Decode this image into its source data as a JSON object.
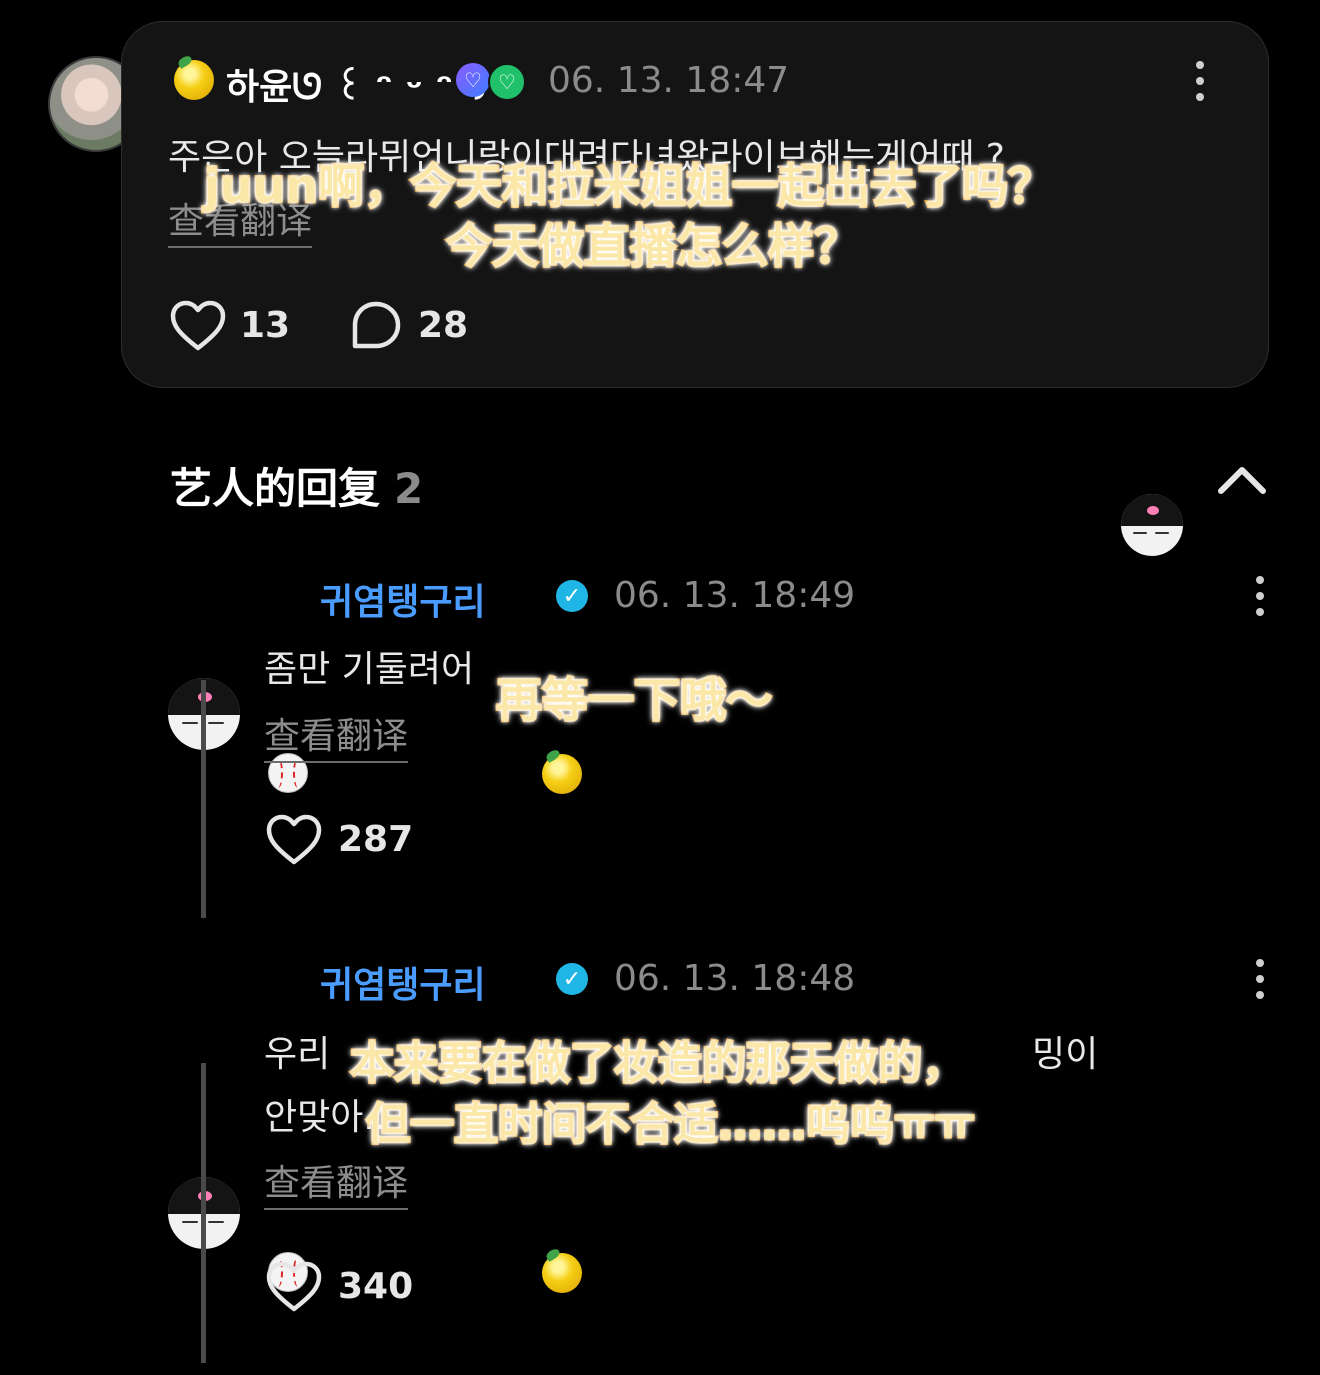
{
  "post": {
    "author_name": "하윤ᘎ ꒰ ᵔ ᵕ ᵔ ꒱ᘎ",
    "timestamp": "06. 13. 18:47",
    "body": "주은아 오늘라뮈언니랑이대려다녀왔라이브해는게어때 ?",
    "translate_label": "查看翻译",
    "like_count": "13",
    "comment_count": "28",
    "icons": [
      "lemon-emoji-icon",
      "weverse-badge-icon",
      "green-heart-badge-icon",
      "more-vert-icon",
      "heart-icon",
      "comment-icon"
    ]
  },
  "replies_header": {
    "title": "艺人的回复",
    "count": "2",
    "collapse_icon": "chevron-up-icon"
  },
  "replies": [
    {
      "author": "귀염탱구리",
      "timestamp": "06. 13. 18:49",
      "body": "좀만 기둘려어",
      "translate_label": "查看翻译",
      "like_count": "287"
    },
    {
      "author": "귀염탱구리",
      "timestamp": "06. 13. 18:48",
      "body_line1_start": "우리",
      "body_line1_end": "밍이",
      "body_line2": "안맞아..",
      "translate_label": "查看翻译",
      "like_count": "340"
    }
  ],
  "subtitles": {
    "post_line1": "juun啊，今天和拉米姐姐一起出去了吗？",
    "post_line2": "今天做直播怎么样？",
    "reply1": "再等一下哦～",
    "reply2_line1": "本来要在做了妆造的那天做的，",
    "reply2_line2": "但一直时间不合适……呜呜ㅠㅠ"
  },
  "colors": {
    "background": "#000000",
    "card": "#141414",
    "artist_name": "#4a9cff",
    "verified": "#1fb6e6",
    "subtitle_fill": "#fbe7a8",
    "subtitle_stroke": "#e38f00"
  }
}
